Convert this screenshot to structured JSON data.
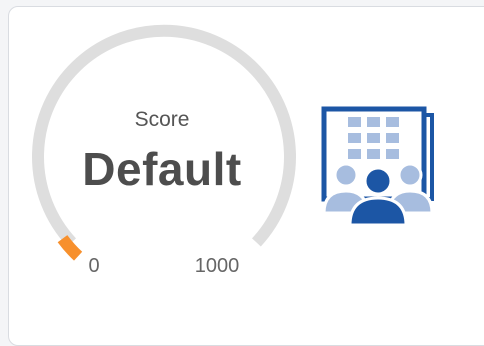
{
  "score_widget": {
    "label": "Score",
    "value": "Default",
    "min_label": "0",
    "max_label": "1000",
    "level_fraction": 0.04
  },
  "colors": {
    "track": "#dedede",
    "fill": "#f7902d",
    "icon_primary": "#1c56a5",
    "icon_light": "#a7bddf",
    "text_dark": "#4d4d4d"
  },
  "icons": {
    "organization": "building-with-people-icon"
  }
}
